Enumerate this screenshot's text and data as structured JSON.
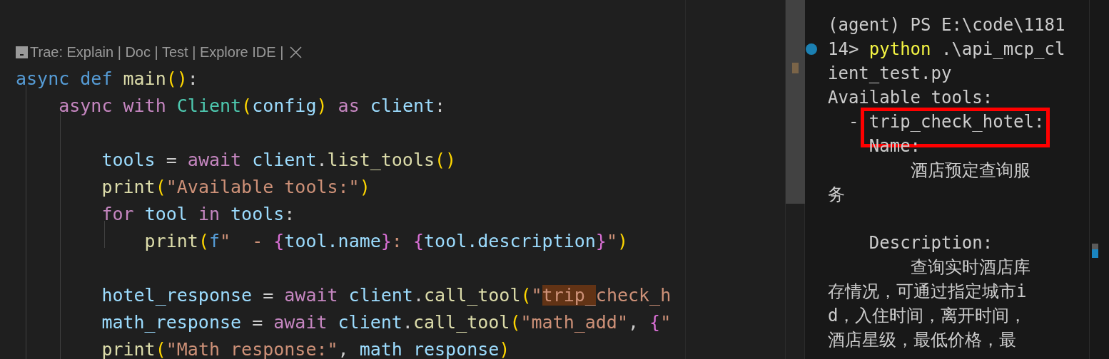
{
  "editor": {
    "lines_before_lens": [
      {
        "kind": "blank"
      },
      {
        "kind": "blank"
      }
    ],
    "code_lens": {
      "text": "Trae: Explain | Doc | Test | Explore IDE | "
    },
    "lines": [
      {
        "tokens": [
          {
            "text": "async def ",
            "kind": "keyword"
          },
          {
            "text": "main",
            "kind": "function"
          },
          {
            "text": "()",
            "kind": "bracket1"
          },
          {
            "text": ":",
            "kind": "plain"
          }
        ]
      },
      {
        "tokens": [
          {
            "text": "    async with ",
            "kind": "control"
          },
          {
            "text": "Client",
            "kind": "class"
          },
          {
            "text": "(",
            "kind": "bracket1"
          },
          {
            "text": "config",
            "kind": "variable"
          },
          {
            "text": ")",
            "kind": "bracket1"
          },
          {
            "text": " as ",
            "kind": "control"
          },
          {
            "text": "client",
            "kind": "variable"
          },
          {
            "text": ":",
            "kind": "plain"
          }
        ]
      },
      {
        "kind": "blank"
      },
      {
        "tokens": [
          {
            "text": "        tools",
            "kind": "variable"
          },
          {
            "text": " = ",
            "kind": "plain"
          },
          {
            "text": "await ",
            "kind": "control"
          },
          {
            "text": "client",
            "kind": "variable"
          },
          {
            "text": ".",
            "kind": "plain"
          },
          {
            "text": "list_tools",
            "kind": "function"
          },
          {
            "text": "()",
            "kind": "bracket1"
          }
        ]
      },
      {
        "tokens": [
          {
            "text": "        print",
            "kind": "function"
          },
          {
            "text": "(",
            "kind": "bracket1"
          },
          {
            "text": "\"Available tools:\"",
            "kind": "string"
          },
          {
            "text": ")",
            "kind": "bracket1"
          }
        ]
      },
      {
        "tokens": [
          {
            "text": "        for ",
            "kind": "control"
          },
          {
            "text": "tool",
            "kind": "variable"
          },
          {
            "text": " in ",
            "kind": "control"
          },
          {
            "text": "tools",
            "kind": "variable"
          },
          {
            "text": ":",
            "kind": "plain"
          }
        ]
      },
      {
        "tokens": [
          {
            "text": "            print",
            "kind": "function"
          },
          {
            "text": "(",
            "kind": "bracket1"
          },
          {
            "text": "f",
            "kind": "keyword"
          },
          {
            "text": "\"  - ",
            "kind": "string"
          },
          {
            "text": "{",
            "kind": "bracket2"
          },
          {
            "text": "tool.name",
            "kind": "variable"
          },
          {
            "text": "}",
            "kind": "bracket2"
          },
          {
            "text": ": ",
            "kind": "string"
          },
          {
            "text": "{",
            "kind": "bracket2"
          },
          {
            "text": "tool.description",
            "kind": "variable"
          },
          {
            "text": "}",
            "kind": "bracket2"
          },
          {
            "text": "\"",
            "kind": "string"
          },
          {
            "text": ")",
            "kind": "bracket1"
          }
        ]
      },
      {
        "kind": "blank"
      },
      {
        "tokens": [
          {
            "text": "        hotel_response",
            "kind": "variable"
          },
          {
            "text": " = ",
            "kind": "plain"
          },
          {
            "text": "await ",
            "kind": "control"
          },
          {
            "text": "client",
            "kind": "variable"
          },
          {
            "text": ".",
            "kind": "plain"
          },
          {
            "text": "call_tool",
            "kind": "function"
          },
          {
            "text": "(",
            "kind": "bracket1"
          },
          {
            "text": "\"",
            "kind": "string"
          },
          {
            "text": "trip_",
            "kind": "string",
            "highlighted": true
          },
          {
            "text": "check_h",
            "kind": "string"
          }
        ]
      },
      {
        "tokens": [
          {
            "text": "        math_response",
            "kind": "variable"
          },
          {
            "text": " = ",
            "kind": "plain"
          },
          {
            "text": "await ",
            "kind": "control"
          },
          {
            "text": "client",
            "kind": "variable"
          },
          {
            "text": ".",
            "kind": "plain"
          },
          {
            "text": "call_tool",
            "kind": "function"
          },
          {
            "text": "(",
            "kind": "bracket1"
          },
          {
            "text": "\"math_add\"",
            "kind": "string"
          },
          {
            "text": ", ",
            "kind": "plain"
          },
          {
            "text": "{",
            "kind": "bracket2"
          },
          {
            "text": "\"",
            "kind": "string"
          }
        ]
      },
      {
        "tokens": [
          {
            "text": "        print",
            "kind": "function"
          },
          {
            "text": "(",
            "kind": "bracket1"
          },
          {
            "text": "\"Math response:\"",
            "kind": "string"
          },
          {
            "text": ", ",
            "kind": "plain"
          },
          {
            "text": "math_response",
            "kind": "variable"
          },
          {
            "text": ")",
            "kind": "bracket1"
          }
        ]
      }
    ]
  },
  "terminal": {
    "lines": [
      {
        "kind": "blank"
      },
      {
        "tokens": [
          {
            "text": "(agent) PS E:\\code\\1181",
            "kind": "plain"
          }
        ]
      },
      {
        "marker": true,
        "tokens": [
          {
            "text": "14> ",
            "kind": "plain"
          },
          {
            "text": "python",
            "kind": "command"
          },
          {
            "text": " .\\api_mcp_cl",
            "kind": "plain"
          }
        ]
      },
      {
        "tokens": [
          {
            "text": "ient_test.py",
            "kind": "plain"
          }
        ]
      },
      {
        "tokens": [
          {
            "text": "Available tools:",
            "kind": "plain"
          }
        ]
      },
      {
        "tokens": [
          {
            "text": "  - ",
            "kind": "plain"
          },
          {
            "text": "trip_check_hotel:",
            "kind": "plain",
            "boxed": true
          }
        ]
      },
      {
        "tokens": [
          {
            "text": "    Name:",
            "kind": "plain"
          }
        ]
      },
      {
        "tokens": [
          {
            "text": "        酒店预定查询服",
            "kind": "plain"
          }
        ]
      },
      {
        "tokens": [
          {
            "text": "务",
            "kind": "plain"
          }
        ]
      },
      {
        "kind": "blank"
      },
      {
        "tokens": [
          {
            "text": "    Description:",
            "kind": "plain"
          }
        ]
      },
      {
        "tokens": [
          {
            "text": "        查询实时酒店库",
            "kind": "plain"
          }
        ]
      },
      {
        "tokens": [
          {
            "text": "存情况，可通过指定城市i",
            "kind": "plain"
          }
        ]
      },
      {
        "tokens": [
          {
            "text": "d，入住时间，离开时间，",
            "kind": "plain"
          }
        ]
      },
      {
        "tokens": [
          {
            "text": "酒店星级，最低价格，最",
            "kind": "plain"
          }
        ]
      }
    ]
  }
}
